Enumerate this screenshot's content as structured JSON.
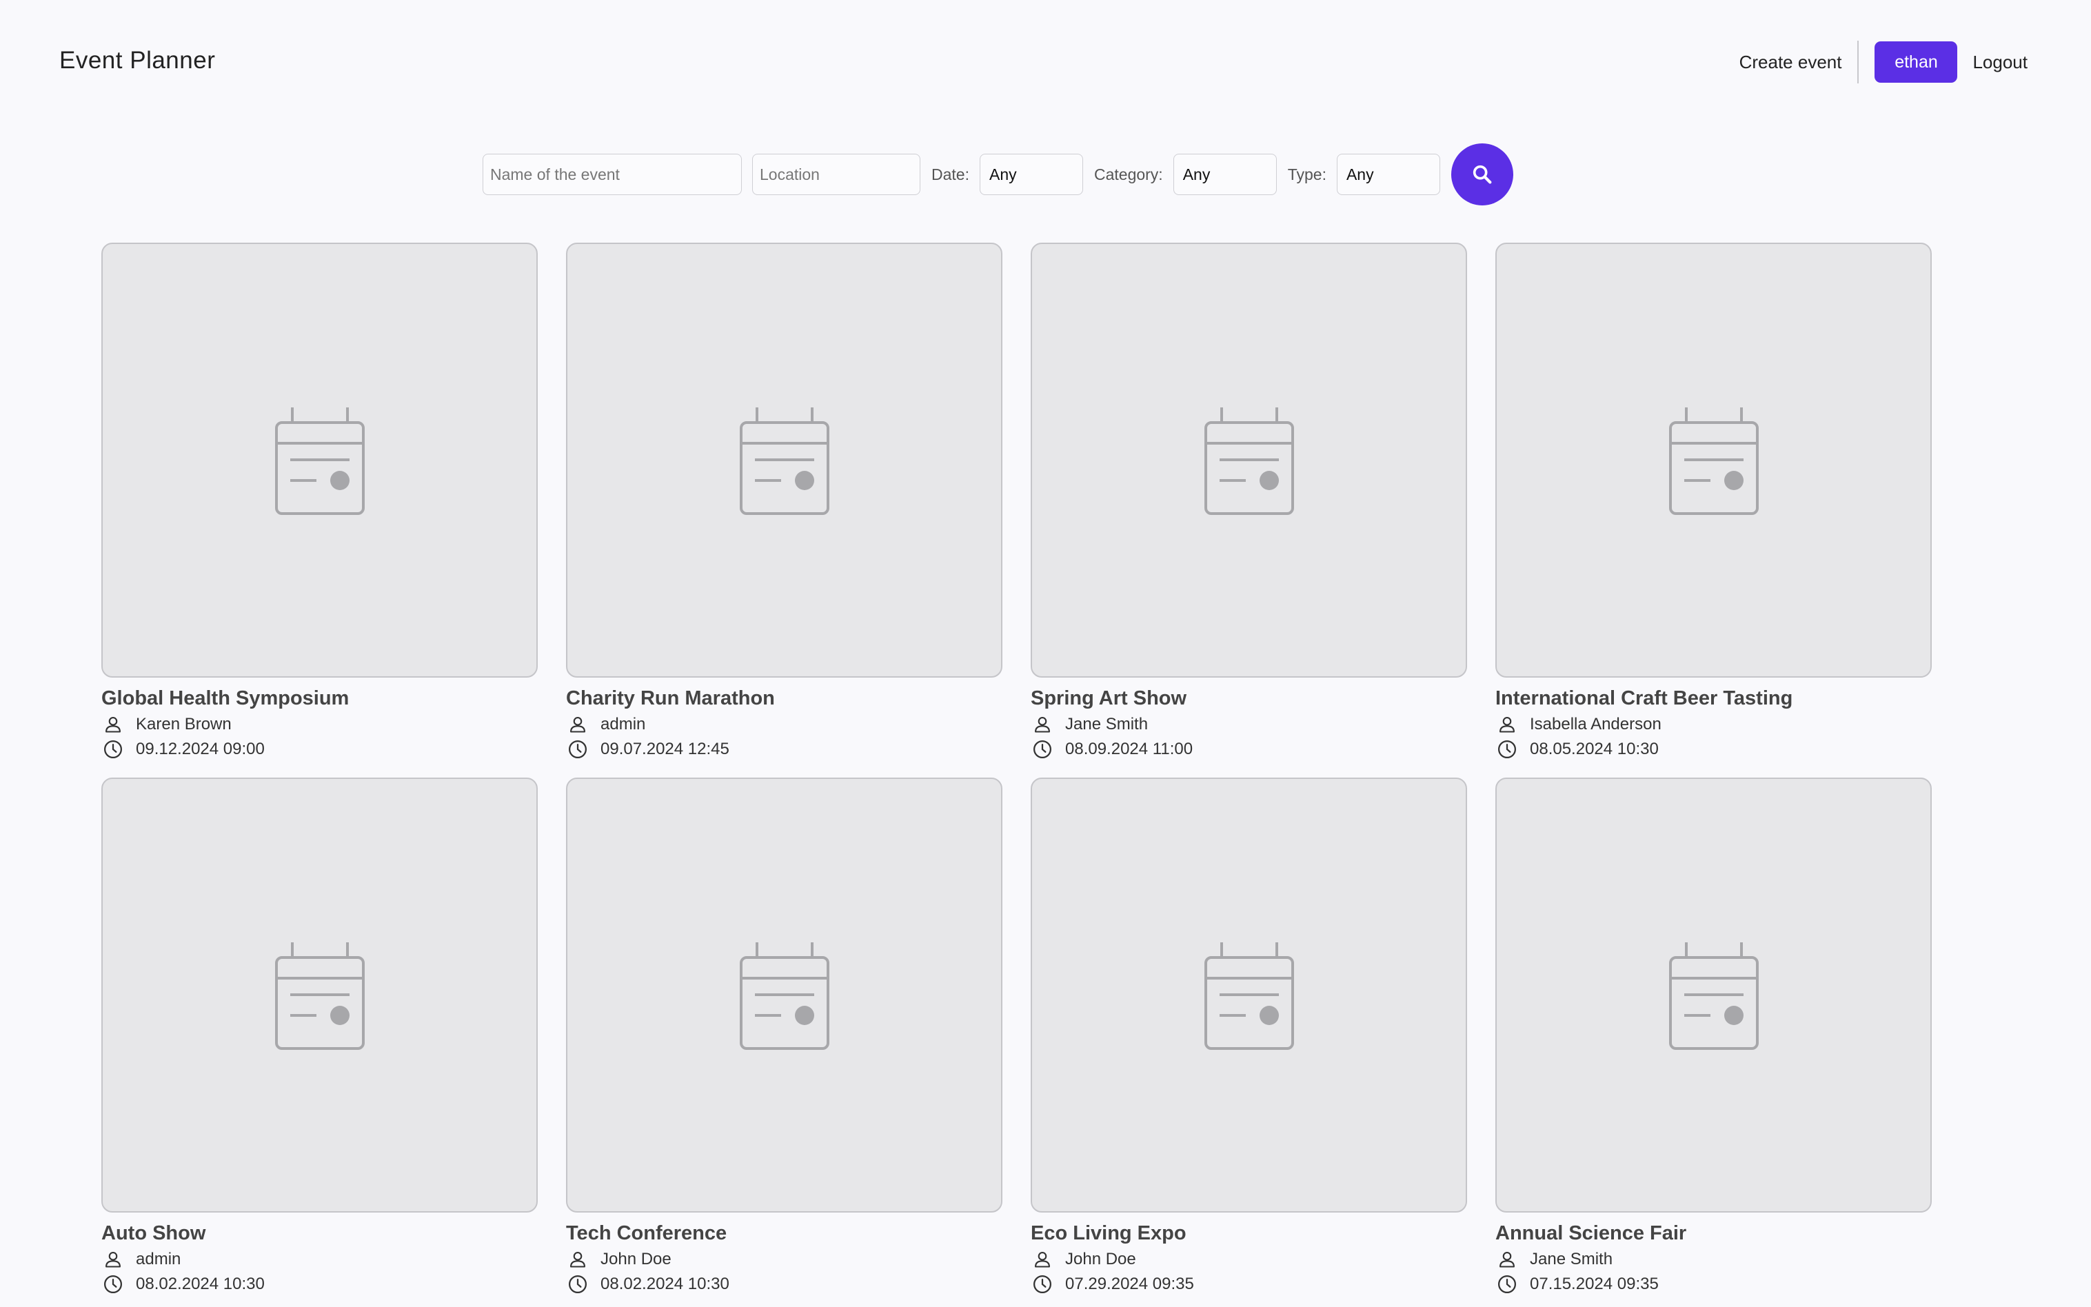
{
  "header": {
    "title": "Event Planner",
    "create_event": "Create event",
    "user": "ethan",
    "logout": "Logout"
  },
  "search": {
    "name_placeholder": "Name of the event",
    "location_placeholder": "Location",
    "date_label": "Date:",
    "date_value": "Any",
    "category_label": "Category:",
    "category_value": "Any",
    "type_label": "Type:",
    "type_value": "Any"
  },
  "events": [
    {
      "title": "Global Health Symposium",
      "organizer": "Karen Brown",
      "datetime": "09.12.2024 09:00"
    },
    {
      "title": "Charity Run Marathon",
      "organizer": "admin",
      "datetime": "09.07.2024 12:45"
    },
    {
      "title": "Spring Art Show",
      "organizer": "Jane Smith",
      "datetime": "08.09.2024 11:00"
    },
    {
      "title": "International Craft Beer Tasting",
      "organizer": "Isabella Anderson",
      "datetime": "08.05.2024 10:30"
    },
    {
      "title": "Auto Show",
      "organizer": "admin",
      "datetime": "08.02.2024 10:30"
    },
    {
      "title": "Tech Conference",
      "organizer": "John Doe",
      "datetime": "08.02.2024 10:30"
    },
    {
      "title": "Eco Living Expo",
      "organizer": "John Doe",
      "datetime": "07.29.2024 09:35"
    },
    {
      "title": "Annual Science Fair",
      "organizer": "Jane Smith",
      "datetime": "07.15.2024 09:35"
    }
  ],
  "colors": {
    "accent": "#5b2fe5",
    "card_bg": "#e7e7e9",
    "page_bg": "#f9f9fc"
  },
  "icons": {
    "placeholder": "calendar-icon",
    "organizer": "person-icon",
    "datetime": "clock-icon",
    "search": "search-icon"
  }
}
